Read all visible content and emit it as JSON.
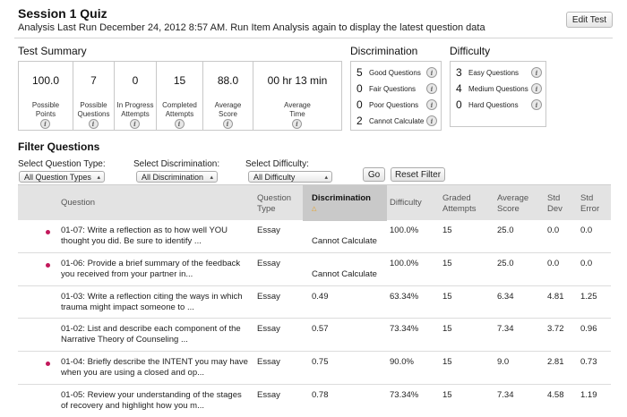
{
  "header": {
    "title": "Session 1 Quiz",
    "analysis_line": "Analysis Last Run  December 24, 2012 8:57 AM.  Run Item Analysis again to display the latest question data",
    "edit_button": "Edit Test"
  },
  "test_summary": {
    "title": "Test Summary",
    "cells": [
      {
        "value": "100.0",
        "label_1": "Possible",
        "label_2": "Points"
      },
      {
        "value": "7",
        "label_1": "Possible",
        "label_2": "Questions"
      },
      {
        "value": "0",
        "label_1": "In Progress",
        "label_2": "Attempts"
      },
      {
        "value": "15",
        "label_1": "Completed",
        "label_2": "Attempts"
      },
      {
        "value": "88.0",
        "label_1": "Average",
        "label_2": "Score"
      },
      {
        "value": "00 hr 13 min",
        "label_1": "Average",
        "label_2": "Time"
      }
    ]
  },
  "discrimination": {
    "title": "Discrimination",
    "rows": [
      {
        "count": "5",
        "label": "Good Questions"
      },
      {
        "count": "0",
        "label": "Fair Questions"
      },
      {
        "count": "0",
        "label": "Poor Questions"
      },
      {
        "count": "2",
        "label": "Cannot Calculate"
      }
    ]
  },
  "difficulty": {
    "title": "Difficulty",
    "rows": [
      {
        "count": "3",
        "label": "Easy Questions"
      },
      {
        "count": "4",
        "label": "Medium Questions"
      },
      {
        "count": "0",
        "label": "Hard Questions"
      }
    ]
  },
  "filter": {
    "title": "Filter Questions",
    "question_type_label": "Select Question Type:",
    "question_type_value": "All Question Types",
    "discrimination_label": "Select Discrimination:",
    "discrimination_value": "All Discrimination",
    "difficulty_label": "Select Difficulty:",
    "difficulty_value": "All Difficulty",
    "go_button": "Go",
    "reset_button": "Reset Filter"
  },
  "table": {
    "columns": {
      "question": "Question",
      "question_type_1": "Question",
      "question_type_2": "Type",
      "discrimination": "Discrimination",
      "difficulty": "Difficulty",
      "graded_1": "Graded",
      "graded_2": "Attempts",
      "avg_1": "Average",
      "avg_2": "Score",
      "std_dev_1": "Std",
      "std_dev_2": "Dev",
      "std_err_1": "Std",
      "std_err_2": "Error"
    },
    "rows": [
      {
        "flag": true,
        "q1": "01-07: Write a reflection as to how well YOU",
        "q2": "thought you did. Be sure to identify ...",
        "type": "Essay",
        "disc": "Cannot Calculate",
        "diff": "100.0%",
        "graded": "15",
        "avg": "25.0",
        "sd": "0.0",
        "se": "0.0"
      },
      {
        "flag": true,
        "q1": "01-06: Provide a brief summary of the feedback",
        "q2": "you received from your partner in...",
        "type": "Essay",
        "disc": "Cannot Calculate",
        "diff": "100.0%",
        "graded": "15",
        "avg": "25.0",
        "sd": "0.0",
        "se": "0.0"
      },
      {
        "flag": false,
        "q1": "01-03: Write a reflection citing the ways in which",
        "q2": "trauma might impact someone to ...",
        "type": "Essay",
        "disc": "0.49",
        "diff": "63.34%",
        "graded": "15",
        "avg": "6.34",
        "sd": "4.81",
        "se": "1.25"
      },
      {
        "flag": false,
        "q1": "01-02: List and describe each component of the",
        "q2": "Narrative Theory of Counseling ...",
        "type": "Essay",
        "disc": "0.57",
        "diff": "73.34%",
        "graded": "15",
        "avg": "7.34",
        "sd": "3.72",
        "se": "0.96"
      },
      {
        "flag": true,
        "q1": "01-04: Briefly describe the INTENT you may have",
        "q2": "when you are using a closed and op...",
        "type": "Essay",
        "disc": "0.75",
        "diff": "90.0%",
        "graded": "15",
        "avg": "9.0",
        "sd": "2.81",
        "se": "0.73"
      },
      {
        "flag": false,
        "q1": "01-05: Review your understanding of the stages",
        "q2": "of recovery and highlight how you m...",
        "type": "Essay",
        "disc": "0.78",
        "diff": "73.34%",
        "graded": "15",
        "avg": "7.34",
        "sd": "4.58",
        "se": "1.19"
      }
    ]
  }
}
